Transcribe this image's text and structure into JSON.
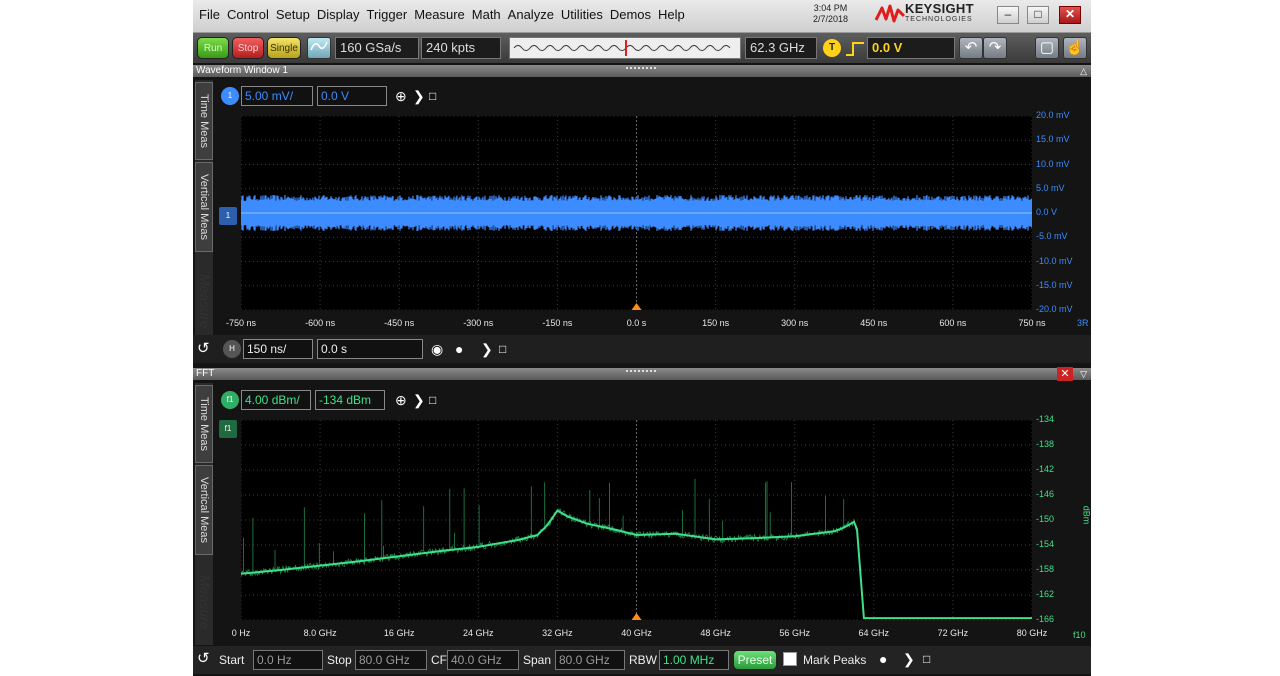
{
  "menu": [
    "File",
    "Control",
    "Setup",
    "Display",
    "Trigger",
    "Measure",
    "Math",
    "Analyze",
    "Utilities",
    "Demos",
    "Help"
  ],
  "clock": {
    "time": "3:04 PM",
    "date": "2/7/2018"
  },
  "brand": {
    "name": "KEYSIGHT",
    "sub": "TECHNOLOGIES"
  },
  "toolbar": {
    "run": "Run",
    "stop": "Stop",
    "single": "Single",
    "sample_rate": "160 GSa/s",
    "memory_depth": "240 kpts",
    "bandwidth": "62.3 GHz",
    "trigger_badge": "T",
    "trigger_level": "0.0 V"
  },
  "waveform_window": {
    "title": "Waveform Window 1",
    "tabs": [
      "Time Meas",
      "Vertical Meas"
    ],
    "faded_tab": "Measure",
    "channel_badge": "1",
    "scale": "5.00 mV/",
    "offset": "0.0 V",
    "x_ticks": [
      "-750 ns",
      "-600 ns",
      "-450 ns",
      "-300 ns",
      "-150 ns",
      "0.0 s",
      "150 ns",
      "300 ns",
      "450 ns",
      "600 ns",
      "750 ns"
    ],
    "y_ticks": [
      "20.0 mV",
      "15.0 mV",
      "10.0 mV",
      "5.0 mV",
      "0.0 V",
      "-5.0 mV",
      "-10.0 mV",
      "-15.0 mV",
      "-20.0 mV"
    ],
    "edge_label": "3R",
    "marker": "1",
    "timebase_badge": "H",
    "timebase": "150 ns/",
    "position": "0.0 s"
  },
  "fft_window": {
    "title": "FFT",
    "tabs": [
      "Time Meas",
      "Vertical Meas"
    ],
    "faded_tab": "Measure",
    "func_badge": "f1",
    "scale": "4.00 dBm/",
    "offset": "-134 dBm",
    "marker": "f1",
    "x_ticks": [
      "0 Hz",
      "8.0 GHz",
      "16 GHz",
      "24 GHz",
      "32 GHz",
      "40 GHz",
      "48 GHz",
      "56 GHz",
      "64 GHz",
      "72 GHz",
      "80 GHz"
    ],
    "y_ticks": [
      "-134",
      "-138",
      "-142",
      "-146",
      "-150",
      "-154",
      "-158",
      "-162",
      "-166"
    ],
    "y_unit": "dBm",
    "edge_label": "f10",
    "start_label": "Start",
    "start_value": "0.0 Hz",
    "stop_label": "Stop",
    "stop_value": "80.0 GHz",
    "cf_label": "CF",
    "cf_value": "40.0 GHz",
    "span_label": "Span",
    "span_value": "80.0 GHz",
    "rbw_label": "RBW",
    "rbw_value": "1.00 MHz",
    "preset": "Preset",
    "mark_peaks": "Mark Peaks"
  },
  "colors": {
    "channel1": "#3d8cff",
    "fft": "#3fe08a",
    "trigger": "#ffd21a",
    "marker": "#ff8c1a"
  },
  "chart_data": [
    {
      "type": "line",
      "xlabel": "",
      "ylabel": "",
      "xlim": [
        -750,
        750
      ],
      "ylim": [
        -20,
        20
      ],
      "series": [
        {
          "x": [
            -750,
            750
          ],
          "values": [
            0.0,
            0.0
          ]
        }
      ]
    },
    {
      "type": "line",
      "xlabel": "",
      "ylabel": "",
      "xlim": [
        0,
        80
      ],
      "ylim": [
        -166,
        -134
      ],
      "series": [
        {
          "x": [
            0,
            4,
            8,
            12,
            16,
            20,
            24,
            28,
            30,
            31,
            32,
            33,
            35,
            38,
            40,
            44,
            48,
            52,
            56,
            60,
            61,
            62,
            62.3,
            63,
            80
          ],
          "values": [
            -158.6,
            -158,
            -157.3,
            -156.6,
            -155.8,
            -155,
            -154.3,
            -153.2,
            -152.4,
            -150.8,
            -148.5,
            -149.4,
            -150.6,
            -151.6,
            -152.4,
            -152.2,
            -153.1,
            -152.9,
            -152.6,
            -151.8,
            -151.2,
            -150.3,
            -151.5,
            -165.7,
            -165.7
          ]
        }
      ]
    }
  ]
}
